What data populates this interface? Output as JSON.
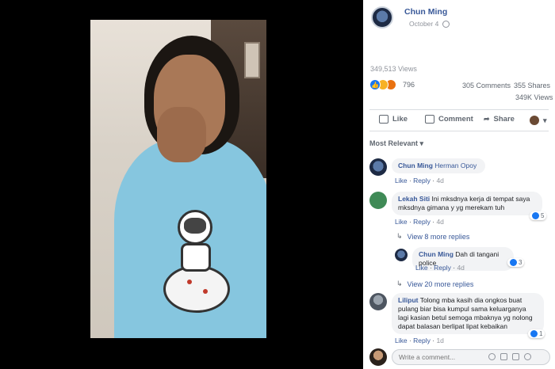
{
  "post": {
    "author": "Chun Ming",
    "date": "October 4",
    "views": "349,513 Views",
    "reaction_count": "796",
    "comments": "305 Comments",
    "shares": "355 Shares",
    "views_short": "349K Views"
  },
  "actions": {
    "like": "Like",
    "comment": "Comment",
    "share": "Share"
  },
  "filter": "Most Relevant",
  "comments": [
    {
      "name": "Chun Ming",
      "text": "Herman Opoy",
      "like": "Like",
      "reply": "Reply",
      "time": "4d"
    },
    {
      "name": "Lekah Siti",
      "text": "Ini mksdnya kerja di tempat saya mksdnya gimana y yg merekam tuh",
      "like": "Like",
      "reply": "Reply",
      "time": "4d",
      "likes": "5"
    },
    {
      "name": "Chun Ming",
      "text": "Dah di tangani police",
      "like": "Like",
      "reply": "Reply",
      "time": "4d",
      "likes": "3"
    },
    {
      "name": "Liliput",
      "text": "Tolong mba kasih dia ongkos buat pulang biar bisa kumpul sama keluarganya lagi kasian betul semoga mbaknya yg nolong dapat balasan berlipat lipat kebaikan",
      "like": "Like",
      "reply": "Reply",
      "time": "1d",
      "likes": "1"
    }
  ],
  "replies": {
    "view_8": "View 8 more replies",
    "view_20": "View 20 more replies"
  },
  "write_comment": {
    "placeholder": "Write a comment..."
  },
  "colors": {
    "link": "#385898",
    "like_blue": "#1877f2",
    "bubble": "#f2f3f5"
  }
}
